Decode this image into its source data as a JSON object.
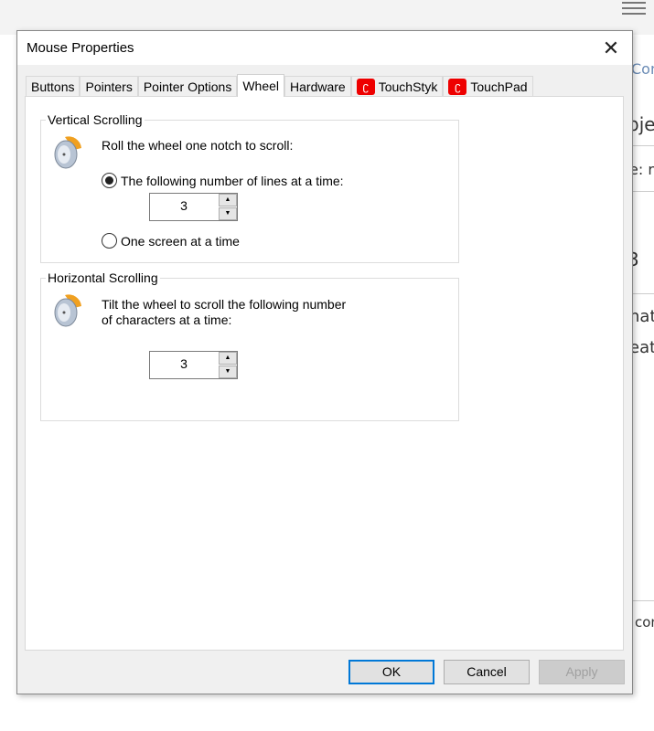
{
  "background": {
    "snippets": [
      "Con",
      "bjec",
      "e: r",
      "3",
      "hat",
      "eatu",
      "con"
    ]
  },
  "dialog": {
    "title": "Mouse Properties",
    "tabs": [
      {
        "label": "Buttons"
      },
      {
        "label": "Pointers"
      },
      {
        "label": "Pointer Options"
      },
      {
        "label": "Wheel",
        "active": true
      },
      {
        "label": "Hardware"
      },
      {
        "label": "TouchStyk",
        "icon": "synaptics-icon"
      },
      {
        "label": "TouchPad",
        "icon": "synaptics-icon"
      }
    ],
    "vertical": {
      "label": "Vertical Scrolling",
      "prompt": "Roll the wheel one notch to scroll:",
      "option_lines": "The following number of lines at a time:",
      "lines_value": "3",
      "option_screen": "One screen at a time",
      "selected": "lines"
    },
    "horizontal": {
      "label": "Horizontal Scrolling",
      "prompt1": "Tilt the wheel to scroll the following number",
      "prompt2": "of characters at a time:",
      "chars_value": "3"
    },
    "buttons": {
      "ok": "OK",
      "cancel": "Cancel",
      "apply": "Apply"
    },
    "colors": {
      "accent": "#0078d7",
      "brand": "#e00000"
    }
  }
}
